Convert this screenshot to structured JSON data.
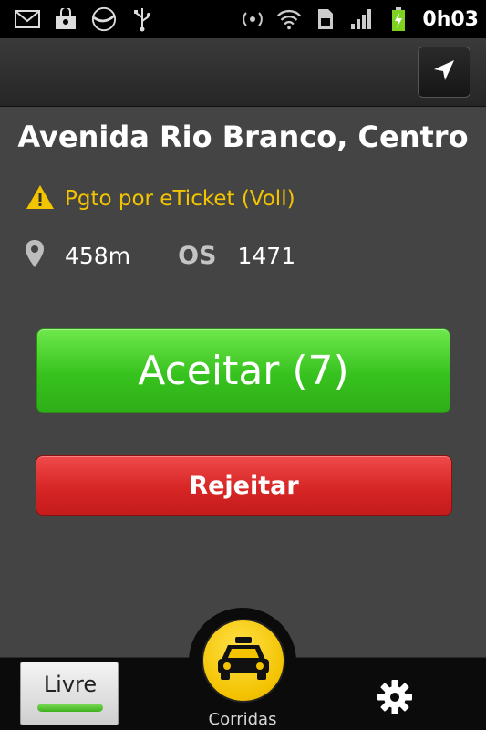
{
  "status_bar": {
    "time": "0h03",
    "left_icons": [
      "gmail-icon",
      "bag-icon",
      "pepsi-icon",
      "usb-icon"
    ],
    "right_icons": [
      "wifi-tethering-icon",
      "wifi-icon",
      "sim-icon",
      "signal-icon",
      "battery-charging-icon"
    ]
  },
  "action_bar": {
    "nav_icon": "navigation-arrow-icon"
  },
  "ride": {
    "address": "Avenida Rio Branco, Centro",
    "payment_warning": "Pgto por eTicket (Voll)",
    "distance": "458m",
    "os_label": "OS",
    "os_number": "1471"
  },
  "actions": {
    "accept_label": "Aceitar (7)",
    "reject_label": "Rejeitar"
  },
  "bottom_bar": {
    "status_label": "Livre",
    "corridas_label": "Corridas",
    "settings_icon": "gear-icon"
  },
  "colors": {
    "accent_yellow": "#f3c400",
    "accept_green": "#37c21e",
    "reject_red": "#d72626",
    "background": "#444444"
  }
}
